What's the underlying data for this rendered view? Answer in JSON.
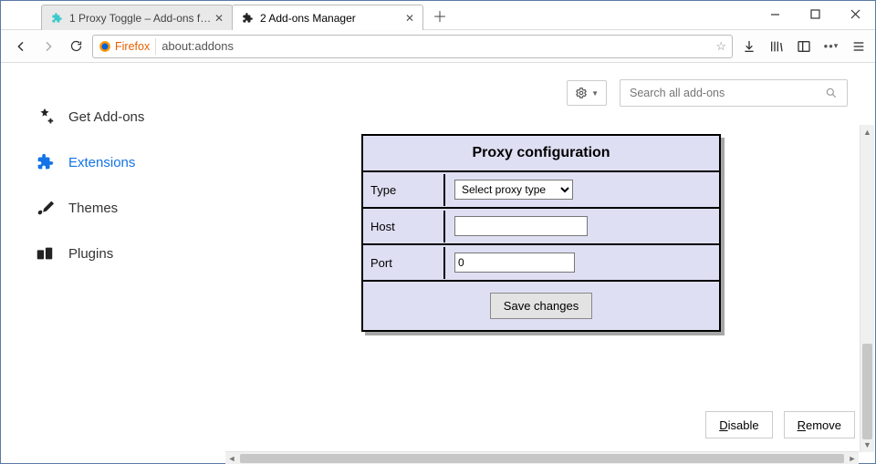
{
  "window": {
    "tabs": [
      {
        "label": "1 Proxy Toggle – Add-ons for Firefox",
        "active": false
      },
      {
        "label": "2 Add-ons Manager",
        "active": true
      }
    ]
  },
  "urlbar": {
    "brand": "Firefox",
    "address": "about:addons"
  },
  "sidebar": {
    "items": [
      {
        "id": "get",
        "label": "Get Add-ons"
      },
      {
        "id": "ext",
        "label": "Extensions"
      },
      {
        "id": "themes",
        "label": "Themes"
      },
      {
        "id": "plugins",
        "label": "Plugins"
      }
    ],
    "active": "ext"
  },
  "search": {
    "placeholder": "Search all add-ons"
  },
  "panel": {
    "title": "Proxy configuration",
    "rows": {
      "type_label": "Type",
      "type_placeholder": "Select proxy type",
      "host_label": "Host",
      "host_value": "",
      "port_label": "Port",
      "port_value": "0"
    },
    "save_label": "Save changes"
  },
  "actions": {
    "disable": "Disable",
    "remove": "Remove"
  }
}
